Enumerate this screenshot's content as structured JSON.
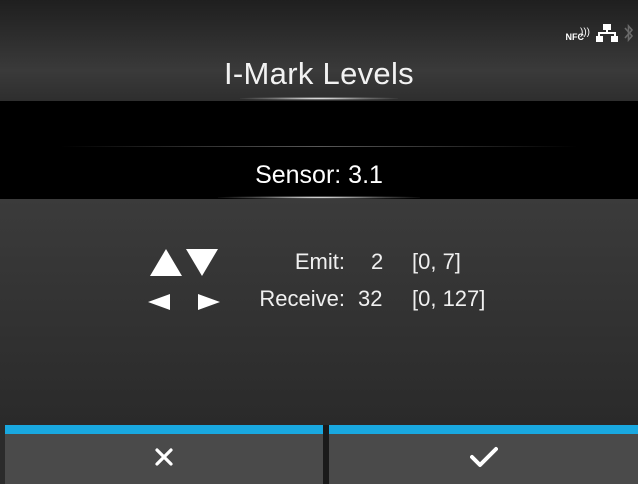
{
  "header": {
    "title": "I-Mark Levels"
  },
  "status": {
    "nfc_label": "NFC",
    "icons": [
      "nfc-icon",
      "network-icon",
      "bluetooth-icon"
    ]
  },
  "sensor_label": "Sensor: 3.1",
  "settings": {
    "emit": {
      "label": "Emit:",
      "value": "2",
      "range": "[0, 7]",
      "adjust_icon": "up-down-arrows-icon"
    },
    "receive": {
      "label": "Receive:",
      "value": "32",
      "range": "[0, 127]",
      "adjust_icon": "left-right-arrows-icon"
    }
  },
  "buttons": {
    "cancel_icon": "close-icon",
    "confirm_icon": "checkmark-icon"
  },
  "colors": {
    "accent": "#19a8e0",
    "background": "#2b2b2b",
    "button": "#4a4a4a"
  }
}
